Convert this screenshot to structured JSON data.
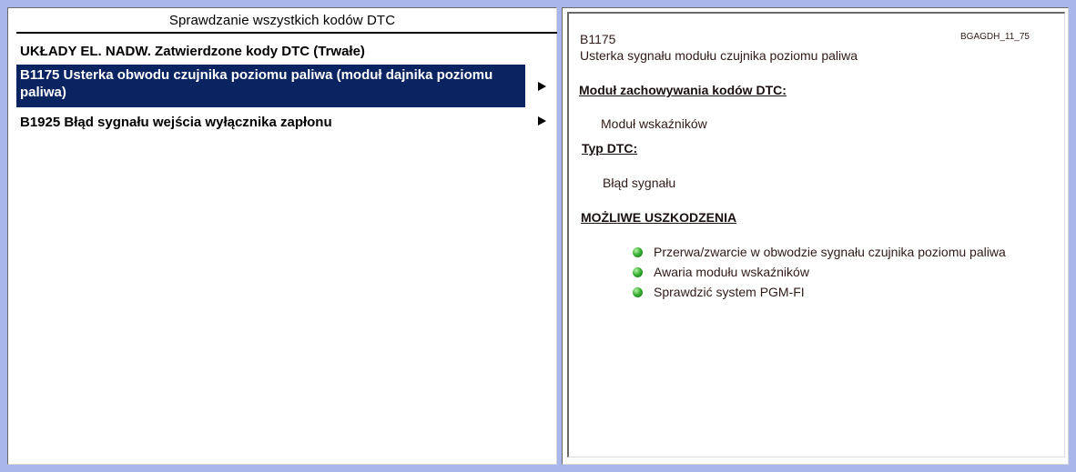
{
  "left_panel": {
    "title": "Sprawdzanie wszystkich kodów DTC",
    "items": [
      {
        "text": "UKŁADY EL. NADW. Zatwierdzone kody DTC (Trwałe)"
      },
      {
        "text": "B1175 Usterka obwodu czujnika poziomu paliwa (moduł dajnika poziomu paliwa)"
      },
      {
        "text": "B1925 Błąd sygnału wejścia wyłącznika zapłonu"
      }
    ]
  },
  "detail": {
    "code": "B1175",
    "description": "Usterka sygnału modułu czujnika poziomu paliwa",
    "ref_code": "BGAGDH_11_75",
    "module_heading": "Moduł zachowywania kodów DTC:",
    "module_value": "Moduł wskaźników",
    "type_heading": "Typ DTC:",
    "type_value": "Błąd sygnału",
    "causes_heading": "MOŻLIWE USZKODZENIA",
    "causes": [
      "Przerwa/zwarcie w obwodzie sygnału czujnika poziomu paliwa",
      "Awaria modułu wskaźników",
      "Sprawdzić system PGM-FI"
    ]
  },
  "colors": {
    "background": "#a9b6ec",
    "selection": "#0a2462",
    "bullet": "#3bb236"
  }
}
